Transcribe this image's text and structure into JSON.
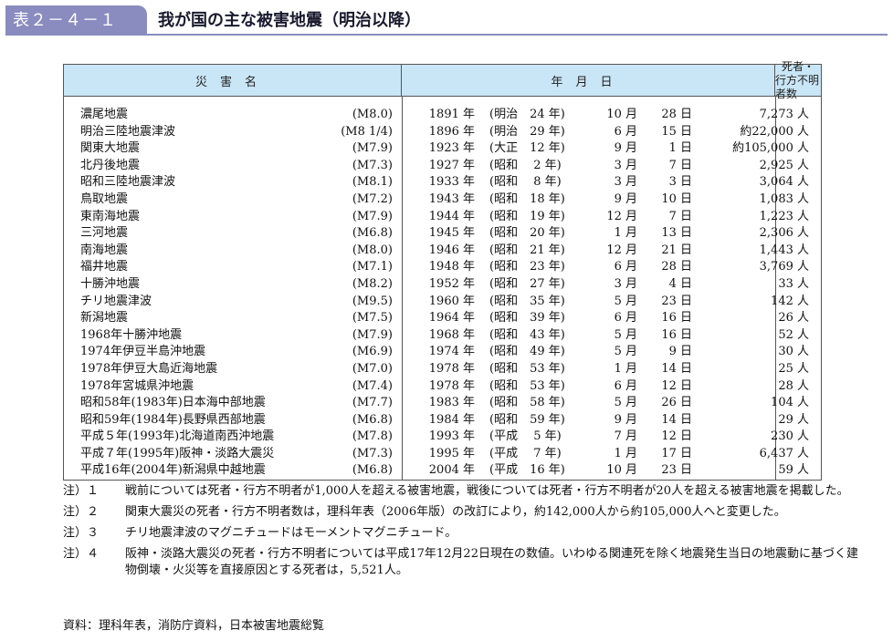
{
  "header": {
    "badge": "表２－４－１",
    "title": "我が国の主な被害地震（明治以降）"
  },
  "table": {
    "columns": {
      "name": "災害名",
      "date": "年月日",
      "dead_line1": "死者・",
      "dead_line2": "行方不明者数"
    },
    "rows": [
      {
        "name": "濃尾地震",
        "mag": "(M8.0)",
        "year": "1891 年",
        "era": "(明治　24 年)",
        "month": "10 月",
        "day": "28 日",
        "dead": "7,273 人"
      },
      {
        "name": "明治三陸地震津波",
        "mag": "(M8 1/4)",
        "year": "1896 年",
        "era": "(明治　29 年)",
        "month": "6 月",
        "day": "15 日",
        "dead": "約22,000 人"
      },
      {
        "name": "関東大地震",
        "mag": "(M7.9)",
        "year": "1923 年",
        "era": "(大正　12 年)",
        "month": "9 月",
        "day": "1 日",
        "dead": "約105,000 人"
      },
      {
        "name": "北丹後地震",
        "mag": "(M7.3)",
        "year": "1927 年",
        "era": "(昭和　 2 年)",
        "month": "3 月",
        "day": "7 日",
        "dead": "2,925 人"
      },
      {
        "name": "昭和三陸地震津波",
        "mag": "(M8.1)",
        "year": "1933 年",
        "era": "(昭和　 8 年)",
        "month": "3 月",
        "day": "3 日",
        "dead": "3,064 人"
      },
      {
        "name": "鳥取地震",
        "mag": "(M7.2)",
        "year": "1943 年",
        "era": "(昭和　18 年)",
        "month": "9 月",
        "day": "10 日",
        "dead": "1,083 人"
      },
      {
        "name": "東南海地震",
        "mag": "(M7.9)",
        "year": "1944 年",
        "era": "(昭和　19 年)",
        "month": "12 月",
        "day": "7 日",
        "dead": "1,223 人"
      },
      {
        "name": "三河地震",
        "mag": "(M6.8)",
        "year": "1945 年",
        "era": "(昭和　20 年)",
        "month": "1 月",
        "day": "13 日",
        "dead": "2,306 人"
      },
      {
        "name": "南海地震",
        "mag": "(M8.0)",
        "year": "1946 年",
        "era": "(昭和　21 年)",
        "month": "12 月",
        "day": "21 日",
        "dead": "1,443 人"
      },
      {
        "name": "福井地震",
        "mag": "(M7.1)",
        "year": "1948 年",
        "era": "(昭和　23 年)",
        "month": "6 月",
        "day": "28 日",
        "dead": "3,769 人"
      },
      {
        "name": "十勝沖地震",
        "mag": "(M8.2)",
        "year": "1952 年",
        "era": "(昭和　27 年)",
        "month": "3 月",
        "day": "4 日",
        "dead": "33 人"
      },
      {
        "name": "チリ地震津波",
        "mag": "(M9.5)",
        "year": "1960 年",
        "era": "(昭和　35 年)",
        "month": "5 月",
        "day": "23 日",
        "dead": "142 人"
      },
      {
        "name": "新潟地震",
        "mag": "(M7.5)",
        "year": "1964 年",
        "era": "(昭和　39 年)",
        "month": "6 月",
        "day": "16 日",
        "dead": "26 人"
      },
      {
        "name": "1968年十勝沖地震",
        "mag": "(M7.9)",
        "year": "1968 年",
        "era": "(昭和　43 年)",
        "month": "5 月",
        "day": "16 日",
        "dead": "52 人"
      },
      {
        "name": "1974年伊豆半島沖地震",
        "mag": "(M6.9)",
        "year": "1974 年",
        "era": "(昭和　49 年)",
        "month": "5 月",
        "day": "9 日",
        "dead": "30 人"
      },
      {
        "name": "1978年伊豆大島近海地震",
        "mag": "(M7.0)",
        "year": "1978 年",
        "era": "(昭和　53 年)",
        "month": "1 月",
        "day": "14 日",
        "dead": "25 人"
      },
      {
        "name": "1978年宮城県沖地震",
        "mag": "(M7.4)",
        "year": "1978 年",
        "era": "(昭和　53 年)",
        "month": "6 月",
        "day": "12 日",
        "dead": "28 人"
      },
      {
        "name": "昭和58年(1983年)日本海中部地震",
        "mag": "(M7.7)",
        "year": "1983 年",
        "era": "(昭和　58 年)",
        "month": "5 月",
        "day": "26 日",
        "dead": "104 人"
      },
      {
        "name": "昭和59年(1984年)長野県西部地震",
        "mag": "(M6.8)",
        "year": "1984 年",
        "era": "(昭和　59 年)",
        "month": "9 月",
        "day": "14 日",
        "dead": "29 人"
      },
      {
        "name": "平成５年(1993年)北海道南西沖地震",
        "mag": "(M7.8)",
        "year": "1993 年",
        "era": "(平成　 5 年)",
        "month": "7 月",
        "day": "12 日",
        "dead": "230 人"
      },
      {
        "name": "平成７年(1995年)阪神・淡路大震災",
        "mag": "(M7.3)",
        "year": "1995 年",
        "era": "(平成　 7 年)",
        "month": "1 月",
        "day": "17 日",
        "dead": "6,437 人"
      },
      {
        "name": "平成16年(2004年)新潟県中越地震",
        "mag": "(M6.8)",
        "year": "2004 年",
        "era": "(平成　16 年)",
        "month": "10 月",
        "day": "23 日",
        "dead": "59 人"
      }
    ]
  },
  "notes": [
    {
      "label": "注）１",
      "text": "戦前については死者・行方不明者が1,000人を超える被害地震，戦後については死者・行方不明者が20人を超える被害地震を掲載した。"
    },
    {
      "label": "注）２",
      "text": "関東大震災の死者・行方不明者数は，理科年表（2006年版）の改訂により，約142,000人から約105,000人へと変更した。"
    },
    {
      "label": "注）３",
      "text": "チリ地震津波のマグニチュードはモーメントマグニチュード。"
    },
    {
      "label": "注）４",
      "text": "阪神・淡路大震災の死者・行方不明者については平成17年12月22日現在の数値。いわゆる関連死を除く地震発生当日の地震動に基づく建物倒壊・火災等を直接原因とする死者は，5,521人。"
    }
  ],
  "source": "資料：理科年表，消防庁資料，日本被害地震総覧",
  "colors": {
    "badge": "#8a8cbf",
    "header_fill": "#c9e6f6"
  }
}
